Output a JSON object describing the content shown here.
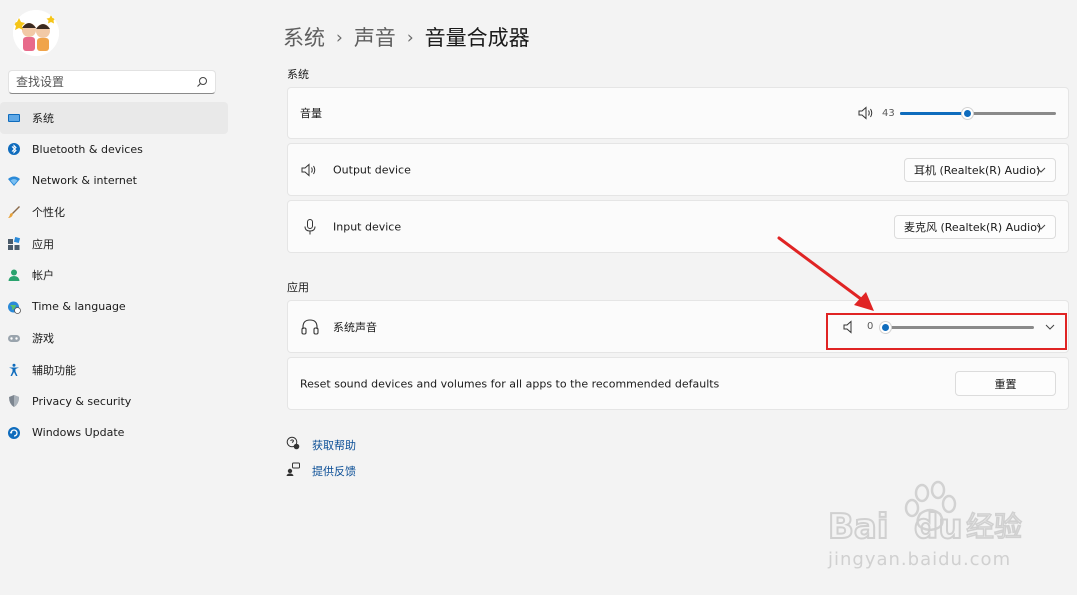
{
  "sidebar": {
    "search_placeholder": "查找设置",
    "items": [
      {
        "label": "系统",
        "icon": "display-icon",
        "active": true
      },
      {
        "label": "Bluetooth & devices",
        "icon": "bluetooth-icon"
      },
      {
        "label": "Network & internet",
        "icon": "wifi-icon"
      },
      {
        "label": "个性化",
        "icon": "brush-icon"
      },
      {
        "label": "应用",
        "icon": "apps-icon"
      },
      {
        "label": "帐户",
        "icon": "person-icon"
      },
      {
        "label": "Time & language",
        "icon": "globe-clock-icon"
      },
      {
        "label": "游戏",
        "icon": "gamepad-icon"
      },
      {
        "label": "辅助功能",
        "icon": "accessibility-icon"
      },
      {
        "label": "Privacy & security",
        "icon": "shield-icon"
      },
      {
        "label": "Windows Update",
        "icon": "update-icon"
      }
    ]
  },
  "breadcrumb": {
    "part1": "系统",
    "part2": "声音",
    "current": "音量合成器",
    "separator": "›"
  },
  "system_section": {
    "heading": "系统",
    "volume": {
      "label": "音量",
      "value": "43",
      "level": 43
    },
    "output": {
      "label": "Output device",
      "selected": "耳机 (Realtek(R) Audio)"
    },
    "input": {
      "label": "Input device",
      "selected": "麦克风 (Realtek(R) Audio)"
    }
  },
  "apps_section": {
    "heading": "应用",
    "system_sounds": {
      "label": "系统声音",
      "value": "0",
      "level": 0
    },
    "reset": {
      "text": "Reset sound devices and volumes for all apps to the recommended defaults",
      "button": "重置"
    }
  },
  "help": {
    "get_help": "获取帮助",
    "feedback": "提供反馈"
  },
  "watermark": {
    "brand": "Baidu经验",
    "url": "jingyan.baidu.com"
  },
  "colors": {
    "accent": "#0f6cbd",
    "annotation": "#e02424",
    "background": "#f3f3f3"
  }
}
